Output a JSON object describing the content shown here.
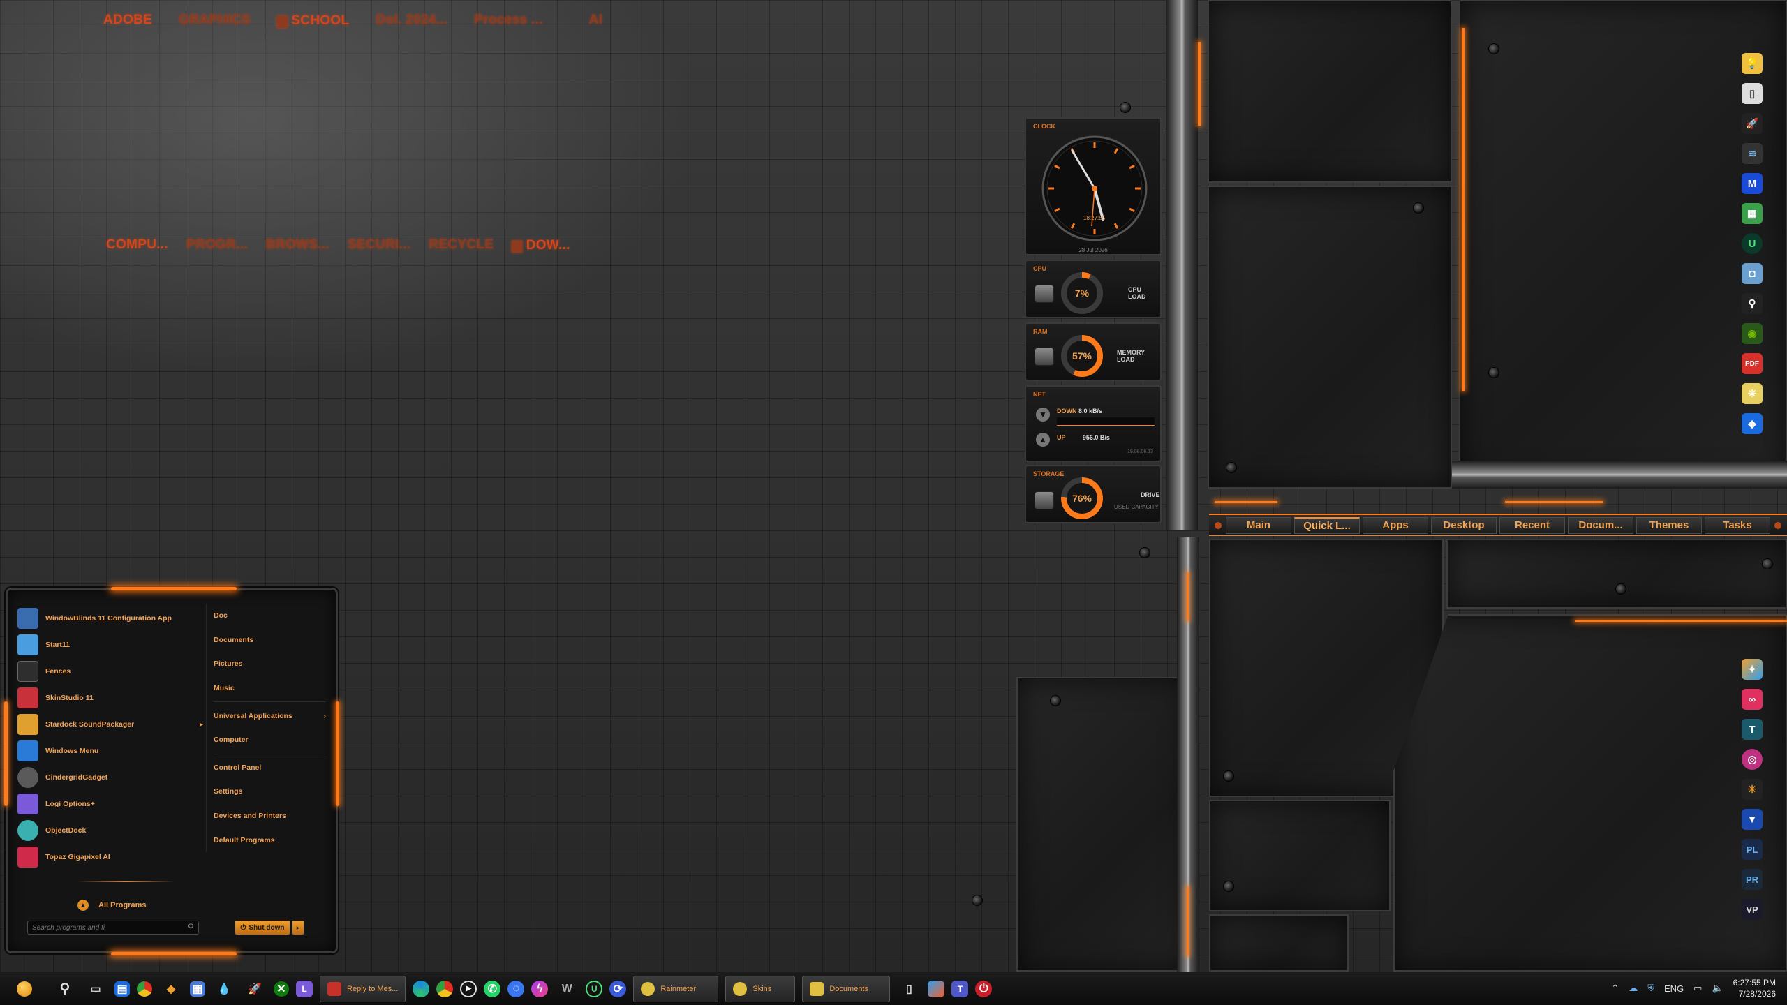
{
  "desktop": {
    "fence_top": [
      "ADOBE",
      "GRAPHICS",
      "SCHOOL",
      "Dol. 2024...",
      "Process ...",
      "AI"
    ],
    "fence_mid": [
      "COMPU...",
      "PROGR...",
      "BROWS...",
      "SECURI...",
      "RECYCLE",
      "DOW..."
    ]
  },
  "widgets": {
    "clock": {
      "title": "CLOCK",
      "time": "18:27:55",
      "date": "28 Jul 2026"
    },
    "cpu": {
      "title": "CPU",
      "value": "7%",
      "label": "CPU LOAD",
      "fraction": 0.07
    },
    "ram": {
      "title": "RAM",
      "value": "57%",
      "label": "MEMORY LOAD",
      "fraction": 0.57
    },
    "net": {
      "title": "NET",
      "down_label": "DOWN",
      "down_value": "8.0 kB/s",
      "up_label": "UP",
      "up_value": "956.0 B/s",
      "stamp": "19.08.06.13"
    },
    "storage": {
      "title": "STORAGE",
      "value": "76%",
      "label": "DRIVE",
      "sublabel": "USED CAPACITY",
      "fraction": 0.76
    }
  },
  "tabs": [
    "Main",
    "Quick L...",
    "Apps",
    "Desktop",
    "Recent",
    "Docum...",
    "Themes",
    "Tasks"
  ],
  "active_tab": "Quick L...",
  "start_menu": {
    "pinned": [
      {
        "label": "WindowBlinds 11 Configuration App",
        "icon": "windowblinds-icon",
        "color": "#3a6cb0"
      },
      {
        "label": "Start11",
        "icon": "start11-icon",
        "color": "#4a9ee0"
      },
      {
        "label": "Fences",
        "icon": "fences-icon",
        "color": "#2e2e2e"
      },
      {
        "label": "SkinStudio 11",
        "icon": "skinstudio-icon",
        "color": "#c8303a"
      },
      {
        "label": "Stardock SoundPackager",
        "icon": "soundpackager-icon",
        "color": "#e0a030",
        "submenu": true
      },
      {
        "label": "Windows Menu",
        "icon": "windows-menu-icon",
        "color": "#2a7ad8"
      },
      {
        "label": "CindergridGadget",
        "icon": "cindergrid-icon",
        "color": "#5a5a5a"
      },
      {
        "label": "Logi Options+",
        "icon": "logi-icon",
        "color": "#7a5ad8"
      },
      {
        "label": "ObjectDock",
        "icon": "objectdock-icon",
        "color": "#3ab0b0"
      },
      {
        "label": "Topaz Gigapixel AI",
        "icon": "topaz-icon",
        "color": "#d02a4a"
      }
    ],
    "links": [
      "Doc",
      "Documents",
      "Pictures",
      "Music",
      "Universal Applications",
      "Computer",
      "Control Panel",
      "Settings",
      "Devices and Printers",
      "Default Programs"
    ],
    "all_programs": "All Programs",
    "search_placeholder": "Search programs and fi",
    "shutdown_label": "Shut down"
  },
  "taskbar": {
    "tasks": [
      {
        "label": "Reply to Mes...",
        "color": "#c8302a"
      },
      {
        "label": "Rainmeter",
        "color": "#e0c040"
      },
      {
        "label": "Skins",
        "color": "#e0c040"
      },
      {
        "label": "Documents",
        "color": "#e0c040"
      }
    ],
    "language": "ENG",
    "time": "6:27:55 PM",
    "date": "7/28/2026"
  },
  "colors": {
    "accent": "#ff7a1a",
    "text_orange": "#f2a253",
    "fence_red": "#d3451c"
  }
}
